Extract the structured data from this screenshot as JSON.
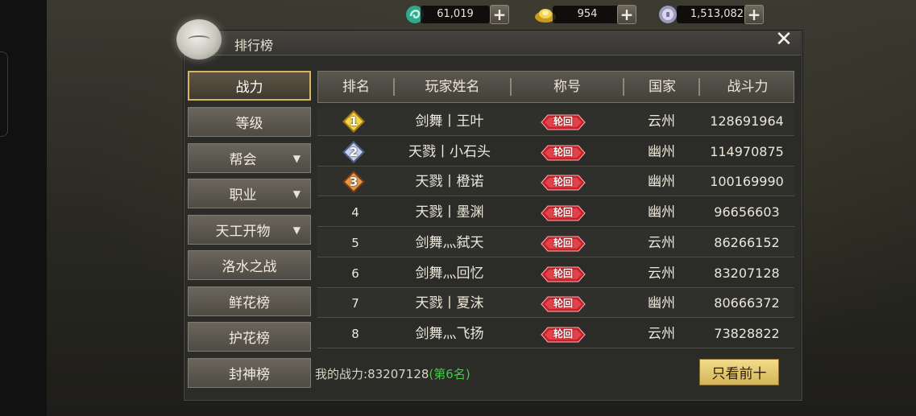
{
  "currencies": [
    {
      "icon": "jade-coin-icon",
      "value": "61,019",
      "color": "#4fd1b0"
    },
    {
      "icon": "gold-ingot-icon",
      "value": "954",
      "color": "#e6c43c"
    },
    {
      "icon": "silver-coin-icon",
      "value": "1,513,082",
      "color": "#b9b6d6"
    }
  ],
  "panel": {
    "title": "排行榜",
    "close_icon": "close-icon"
  },
  "menu": [
    {
      "label": "战力",
      "active": true,
      "has_arrow": false
    },
    {
      "label": "等级",
      "active": false,
      "has_arrow": false
    },
    {
      "label": "帮会",
      "active": false,
      "has_arrow": true
    },
    {
      "label": "职业",
      "active": false,
      "has_arrow": true
    },
    {
      "label": "天工开物",
      "active": false,
      "has_arrow": true
    },
    {
      "label": "洛水之战",
      "active": false,
      "has_arrow": false
    },
    {
      "label": "鲜花榜",
      "active": false,
      "has_arrow": false
    },
    {
      "label": "护花榜",
      "active": false,
      "has_arrow": false
    },
    {
      "label": "封神榜",
      "active": false,
      "has_arrow": false
    }
  ],
  "menu_arrow": "▼",
  "table": {
    "headers": [
      "排名",
      "玩家姓名",
      "称号",
      "国家",
      "战斗力"
    ],
    "rows": [
      {
        "rank": "1",
        "name": "剑舞丨王叶",
        "title": "轮回",
        "country": "云州",
        "power": "128691964",
        "medal": "gold"
      },
      {
        "rank": "2",
        "name": "天戮丨小石头",
        "title": "轮回",
        "country": "幽州",
        "power": "114970875",
        "medal": "silver"
      },
      {
        "rank": "3",
        "name": "天戮丨橙诺",
        "title": "轮回",
        "country": "幽州",
        "power": "100169990",
        "medal": "bronze"
      },
      {
        "rank": "4",
        "name": "天戮丨墨渊",
        "title": "轮回",
        "country": "幽州",
        "power": "96656603",
        "medal": ""
      },
      {
        "rank": "5",
        "name": "剑舞灬弑天",
        "title": "轮回",
        "country": "云州",
        "power": "86266152",
        "medal": ""
      },
      {
        "rank": "6",
        "name": "剑舞灬回忆",
        "title": "轮回",
        "country": "云州",
        "power": "83207128",
        "medal": ""
      },
      {
        "rank": "7",
        "name": "天戮丨夏沫",
        "title": "轮回",
        "country": "幽州",
        "power": "80666372",
        "medal": ""
      },
      {
        "rank": "8",
        "name": "剑舞灬飞扬",
        "title": "轮回",
        "country": "云州",
        "power": "73828822",
        "medal": ""
      }
    ]
  },
  "footer": {
    "my_power_label": "我的战力:",
    "my_power_value": "83207128",
    "my_rank": "(第6名)",
    "top10_button": "只看前十"
  },
  "colors": {
    "accent_gold": "#d7b560",
    "rank_green": "#3fce3f",
    "badge_red": "#c8202a"
  }
}
